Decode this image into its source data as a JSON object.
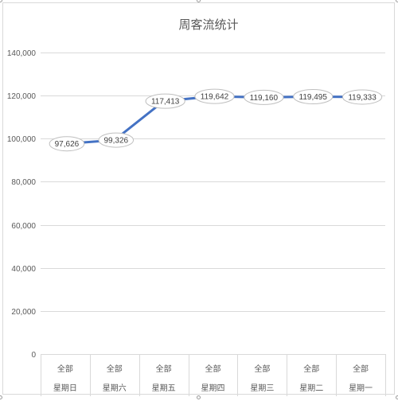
{
  "chart_data": {
    "type": "line",
    "title": "周客流统计",
    "categories": [
      [
        "全部",
        "星期日"
      ],
      [
        "全部",
        "星期六"
      ],
      [
        "全部",
        "星期五"
      ],
      [
        "全部",
        "星期四"
      ],
      [
        "全部",
        "星期三"
      ],
      [
        "全部",
        "星期二"
      ],
      [
        "全部",
        "星期一"
      ]
    ],
    "series": [
      {
        "values": [
          97626,
          99326,
          117413,
          119642,
          119160,
          119495,
          119333
        ]
      }
    ],
    "value_labels": [
      "97,626",
      "99,326",
      "117,413",
      "119,642",
      "119,160",
      "119,495",
      "119,333"
    ],
    "ylim": [
      0,
      140000
    ],
    "yticks": [
      0,
      20000,
      40000,
      60000,
      80000,
      100000,
      120000,
      140000
    ],
    "ytick_labels": [
      "0",
      "20,000",
      "40,000",
      "60,000",
      "80,000",
      "100,000",
      "120,000",
      "140,000"
    ],
    "xlabel": "",
    "ylabel": "",
    "grid": true,
    "legend": "none",
    "colors": {
      "line": "#4472c4",
      "grid": "#d9d9d9",
      "text": "#595959",
      "label_border": "#bfbfbf"
    }
  }
}
